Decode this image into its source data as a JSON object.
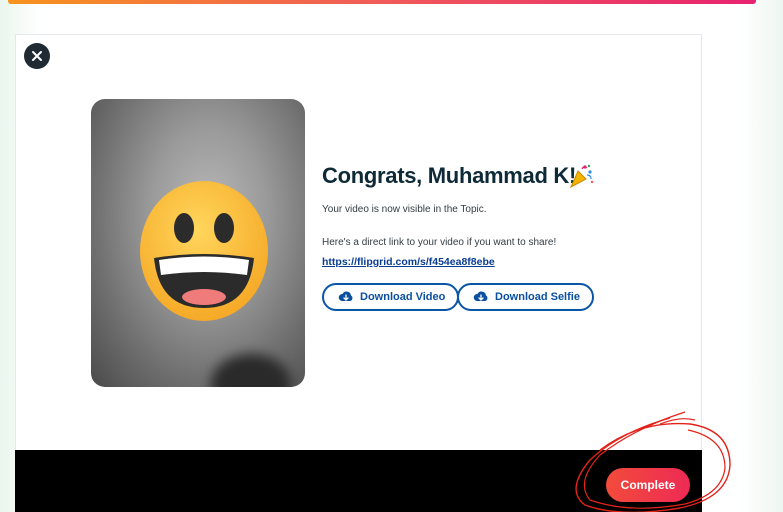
{
  "modal": {
    "heading": "Congrats, Muhammad K!",
    "celebration_icon": "party-popper-icon",
    "visible_message": "Your video is now visible in the Topic.",
    "share_prompt": "Here's a direct link to your video if you want to share!",
    "share_link": "https://flipgrid.com/s/f454ea8f8ebe",
    "download_video_label": "Download Video",
    "download_selfie_label": "Download Selfie",
    "close_icon": "close-icon",
    "thumbnail_icon": "grinning-face-icon"
  },
  "footer": {
    "complete_label": "Complete"
  },
  "colors": {
    "accent_blue": "#0a55a6",
    "complete_red": "#f24b3b",
    "heading_navy": "#0d2a36",
    "annotation_red": "#e2231a"
  }
}
